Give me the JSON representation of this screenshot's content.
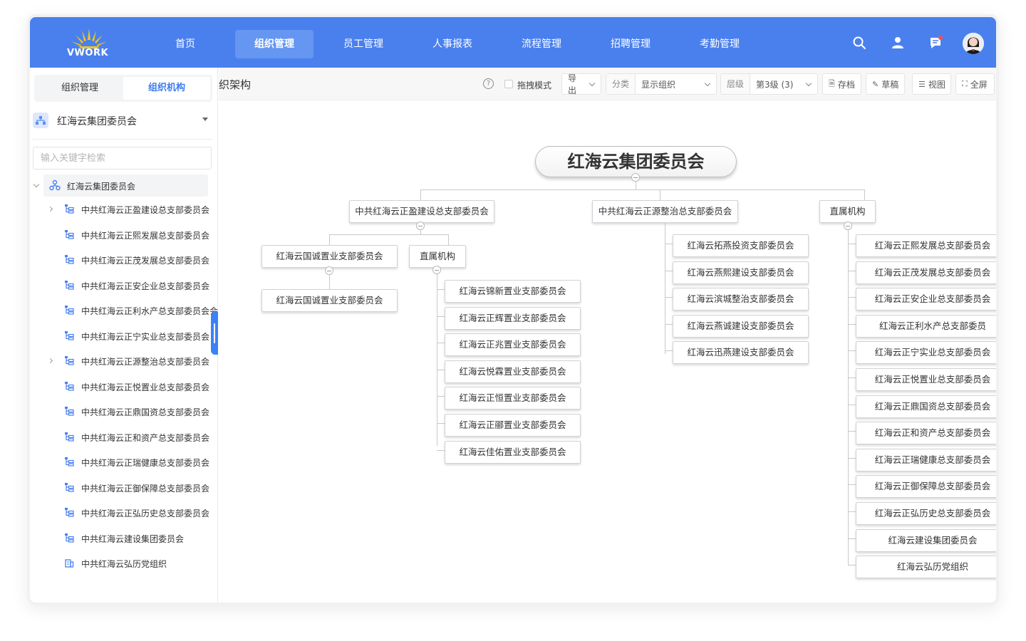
{
  "logo": {
    "text": "VWORK"
  },
  "nav": {
    "items": [
      "首页",
      "组织管理",
      "员工管理",
      "人事报表",
      "流程管理",
      "招聘管理",
      "考勤管理"
    ],
    "active": "组织管理"
  },
  "header_icons": [
    "search-icon",
    "user-icon",
    "message-icon",
    "avatar"
  ],
  "colors": {
    "primary": "#4a80ee",
    "accent": "#3c7cf0",
    "nav_active": "#6596f2"
  },
  "sidebar": {
    "tabs": [
      "组织管理",
      "组织机构"
    ],
    "active_tab": "组织机构",
    "org_select": "红海云集团委员会",
    "search_placeholder": "输入关键字检索",
    "tree_root": "红海云集团委员会",
    "items": [
      {
        "label": "中共红海云正盈建设总支部委员会",
        "expandable": true,
        "icon": "org-tree-icon"
      },
      {
        "label": "中共红海云正熙发展总支部委员会",
        "expandable": false,
        "icon": "org-tree-icon"
      },
      {
        "label": "中共红海云正茂发展总支部委员会",
        "expandable": false,
        "icon": "org-tree-icon"
      },
      {
        "label": "中共红海云正安企业总支部委员会",
        "expandable": false,
        "icon": "org-tree-icon"
      },
      {
        "label": "中共红海云正利水产总支部委员会会",
        "expandable": false,
        "icon": "org-tree-icon"
      },
      {
        "label": "中共红海云正宁实业总支部委员会",
        "expandable": false,
        "icon": "org-tree-icon"
      },
      {
        "label": "中共红海云正源整治总支部委员会",
        "expandable": true,
        "icon": "org-tree-icon"
      },
      {
        "label": "中共红海云正悦置业总支部委员会",
        "expandable": false,
        "icon": "org-tree-icon"
      },
      {
        "label": "中共红海云正鼎国资总支部委员会",
        "expandable": false,
        "icon": "org-tree-icon"
      },
      {
        "label": "中共红海云正和资产总支部委员会",
        "expandable": false,
        "icon": "org-tree-icon"
      },
      {
        "label": "中共红海云正瑞健康总支部委员会",
        "expandable": false,
        "icon": "org-tree-icon"
      },
      {
        "label": "中共红海云正御保障总支部委员会",
        "expandable": false,
        "icon": "org-tree-icon"
      },
      {
        "label": "中共红海云正弘历史总支部委员会",
        "expandable": false,
        "icon": "org-tree-icon"
      },
      {
        "label": "中共红海云建设集团委员会",
        "expandable": false,
        "icon": "org-tree-icon"
      },
      {
        "label": "中共红海云弘历党组织",
        "expandable": false,
        "icon": "building-icon"
      }
    ]
  },
  "toolbar": {
    "title": "织架构",
    "drag_mode": "拖拽模式",
    "export": "导出",
    "category_label": "分类",
    "category_value": "显示组织",
    "level_label": "层级",
    "level_value": "第3级 (3)",
    "save": "存档",
    "draft": "草稿",
    "view": "视图",
    "fullscreen": "全屏"
  },
  "org_chart": {
    "root": "红海云集团委员会",
    "branches": [
      {
        "name": "中共红海云正盈建设总支部委员会",
        "children": [
          {
            "name": "红海云国诚置业支部委员会",
            "children": [
              "红海云国诚置业支部委员会"
            ]
          },
          {
            "name": "直属机构",
            "children": [
              "红海云锦新置业支部委员会",
              "红海云正辉置业支部委员会",
              "红海云正兆置业支部委员会",
              "红海云悦霖置业支部委员会",
              "红海云正恒置业支部委员会",
              "红海云正郦置业支部委员会",
              "红海云佳佑置业支部委员会"
            ]
          }
        ]
      },
      {
        "name": "中共红海云正源整治总支部委员会",
        "children": [
          "红海云拓燕投资支部委员会",
          "红海云燕熙建设支部委员会",
          "红海云滨城整治支部委员会",
          "红海云燕诚建设支部委员会",
          "红海云迅燕建设支部委员会"
        ]
      },
      {
        "name": "直属机构",
        "children": [
          "红海云正熙发展总支部委员会",
          "红海云正茂发展总支部委员会",
          "红海云正安企业总支部委员会",
          "红海云正利水产总支部委员",
          "红海云正宁实业总支部委员会",
          "红海云正悦置业总支部委员会",
          "红海云正鼎国资总支部委员会",
          "红海云正和资产总支部委员会",
          "红海云正瑞健康总支部委员会",
          "红海云正御保障总支部委员会",
          "红海云正弘历史总支部委员会",
          "红海云建设集团委员会",
          "红海云弘历党组织"
        ]
      }
    ]
  }
}
